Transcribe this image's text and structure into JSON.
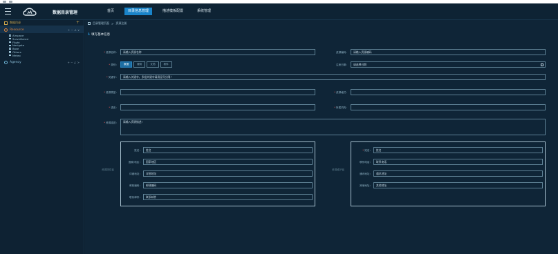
{
  "app": {
    "title": "数据目录管理",
    "nav": [
      {
        "label": "首页",
        "active": false
      },
      {
        "label": "目录信息管理",
        "active": true
      },
      {
        "label": "描述模板配置",
        "active": false
      },
      {
        "label": "系统管理",
        "active": false
      }
    ]
  },
  "sidebar": {
    "header": "数据目录",
    "add": "+",
    "nodes": [
      {
        "label": "Resource",
        "actions": "+ − ∠ ∨",
        "children": [
          "Airspace",
          "Surveillance",
          "Flight",
          "Navigate",
          "Base",
          "Others",
          "Meteo"
        ]
      },
      {
        "label": "Agency",
        "actions": "+ − ∠ >"
      }
    ]
  },
  "breadcrumb": {
    "root": "目录管理页面",
    "sep": ">",
    "current": "资源注册"
  },
  "section": {
    "num": "1",
    "title": "填写基本信息"
  },
  "form": {
    "name": {
      "label": "资源名称：",
      "placeholder": "请输入资源名称"
    },
    "code": {
      "label": "资源编码：",
      "placeholder": "请输入资源编码"
    },
    "type": {
      "label": "类别：",
      "options": [
        "数据",
        "服务",
        "文档",
        "软件"
      ],
      "selected": 0
    },
    "date": {
      "label": "注册日期：",
      "placeholder": "请选择日期"
    },
    "keyword": {
      "label": "关键字：",
      "placeholder": "请输入关键字，多组关键字请用逗号分隔！"
    },
    "f1": {
      "label": "资源类型："
    },
    "f2": {
      "label": "资源格式："
    },
    "f3": {
      "label": "语言："
    },
    "f4": {
      "label": "所属机构："
    },
    "desc": {
      "label": "资源描述：",
      "placeholder": "请输入资源描述!"
    }
  },
  "panel_left": {
    "tag": "资源提供者",
    "fields": [
      {
        "label": "姓名：",
        "placeholder": "姓名"
      },
      {
        "label": "国家/地区：",
        "placeholder": "国家地区"
      },
      {
        "label": "详细地址：",
        "placeholder": "详细地址"
      },
      {
        "label": "邮政编码：",
        "placeholder": "邮政编码"
      },
      {
        "label": "联系邮件：",
        "placeholder": "联系邮件"
      }
    ]
  },
  "panel_right": {
    "tag": "资源维护者",
    "fields": [
      {
        "label": "姓名：",
        "placeholder": "姓名"
      },
      {
        "label": "联系电话：",
        "placeholder": "联系电话"
      },
      {
        "label": "通讯地址：",
        "placeholder": "通讯地址"
      },
      {
        "label": "其他地址：",
        "placeholder": "其他地址"
      }
    ]
  },
  "colors": {
    "accent": "#1a84c9",
    "sidebar_header": "#c9a24a",
    "resource": "#e0843a",
    "required": "#e05757"
  }
}
